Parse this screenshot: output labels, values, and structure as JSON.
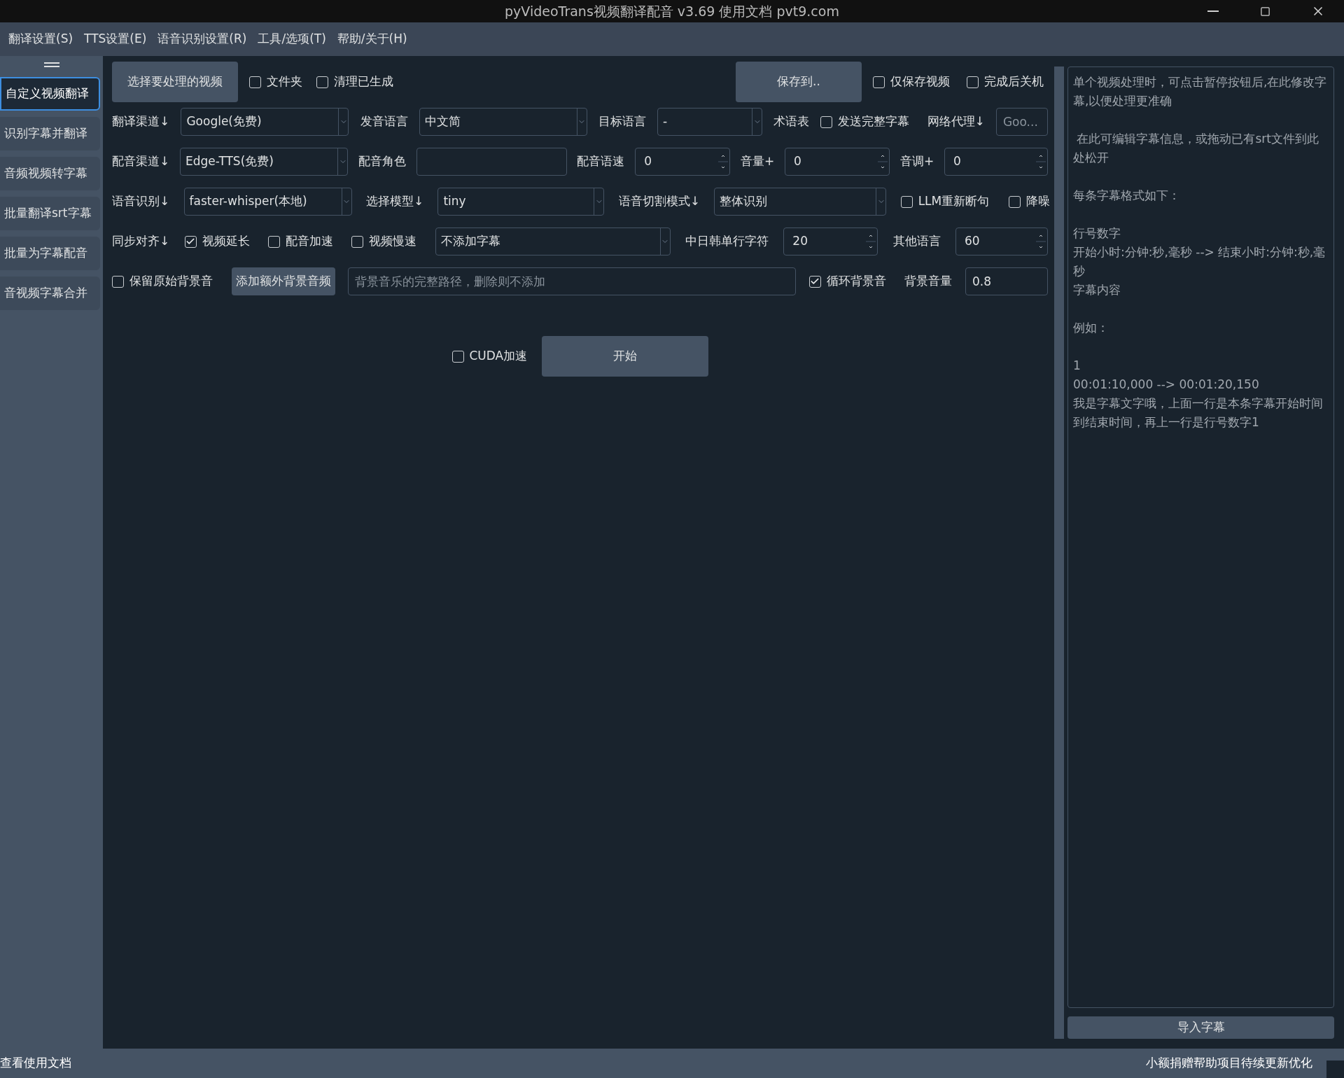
{
  "window": {
    "title": "pyVideoTrans视频翻译配音 v3.69 使用文档 pvt9.com"
  },
  "menu": [
    "翻译设置(S)",
    "TTS设置(E)",
    "语音识别设置(R)",
    "工具/选项(T)",
    "帮助/关于(H)"
  ],
  "sidebar": {
    "items": [
      {
        "label": "自定义视频翻译",
        "selected": true
      },
      {
        "label": "识别字幕并翻译",
        "selected": false
      },
      {
        "label": "音频视频转字幕",
        "selected": false
      },
      {
        "label": "批量翻译srt字幕",
        "selected": false
      },
      {
        "label": "批量为字幕配音",
        "selected": false
      },
      {
        "label": "音视频字幕合并",
        "selected": false
      }
    ]
  },
  "rows": [
    {
      "items": [
        {
          "kind": "button",
          "label": "选择要处理的视频"
        },
        {
          "kind": "checkbox",
          "label": "文件夹",
          "checked": false
        },
        {
          "kind": "checkbox",
          "label": "清理已生成",
          "checked": false
        },
        {
          "kind": "button",
          "label": "保存到.."
        },
        {
          "kind": "checkbox",
          "label": "仅保存视频",
          "checked": false
        },
        {
          "kind": "checkbox",
          "label": "完成后关机",
          "checked": false
        }
      ]
    },
    {
      "items": [
        {
          "kind": "label",
          "label": "翻译渠道↓"
        },
        {
          "kind": "combo",
          "value": "Google(免费)"
        },
        {
          "kind": "label",
          "label": "发音语言"
        },
        {
          "kind": "combo",
          "value": "中文简"
        },
        {
          "kind": "label",
          "label": "目标语言"
        },
        {
          "kind": "combo",
          "value": "-"
        },
        {
          "kind": "label",
          "label": "术语表"
        },
        {
          "kind": "checkbox",
          "label": "发送完整字幕",
          "checked": false
        },
        {
          "kind": "label",
          "label": "网络代理↓"
        },
        {
          "kind": "field",
          "placeholder": "Goo..."
        }
      ]
    },
    {
      "items": [
        {
          "kind": "label",
          "label": "配音渠道↓"
        },
        {
          "kind": "combo",
          "value": "Edge-TTS(免费)"
        },
        {
          "kind": "label",
          "label": "配音角色"
        },
        {
          "kind": "field"
        },
        {
          "kind": "label",
          "label": "配音语速"
        },
        {
          "kind": "spin",
          "value": "0"
        },
        {
          "kind": "label",
          "label": "音量+"
        },
        {
          "kind": "spin",
          "value": "0"
        },
        {
          "kind": "label",
          "label": "音调+"
        },
        {
          "kind": "spin",
          "value": "0"
        }
      ]
    },
    {
      "items": [
        {
          "kind": "label",
          "label": "语音识别↓"
        },
        {
          "kind": "combo",
          "value": "faster-whisper(本地)"
        },
        {
          "kind": "label",
          "label": "选择模型↓"
        },
        {
          "kind": "combo",
          "value": "tiny"
        },
        {
          "kind": "label",
          "label": "语音切割模式↓"
        },
        {
          "kind": "combo",
          "value": "整体识别"
        },
        {
          "kind": "checkbox",
          "label": "LLM重新断句",
          "checked": false
        },
        {
          "kind": "checkbox",
          "label": "降噪",
          "checked": false
        }
      ]
    },
    {
      "items": [
        {
          "kind": "label",
          "label": "同步对齐↓"
        },
        {
          "kind": "checkbox",
          "label": "视频延长",
          "checked": true
        },
        {
          "kind": "checkbox",
          "label": "配音加速",
          "checked": false
        },
        {
          "kind": "checkbox",
          "label": "视频慢速",
          "checked": false
        },
        {
          "kind": "combo",
          "value": "不添加字幕"
        },
        {
          "kind": "label",
          "label": "中日韩单行字符"
        },
        {
          "kind": "spin",
          "value": "20"
        },
        {
          "kind": "label",
          "label": "其他语言"
        },
        {
          "kind": "spin",
          "value": "60"
        }
      ]
    },
    {
      "items": [
        {
          "kind": "checkbox",
          "label": "保留原始背景音",
          "checked": false
        },
        {
          "kind": "button",
          "label": "添加额外背景音频"
        },
        {
          "kind": "field",
          "placeholder": "背景音乐的完整路径，删除则不添加"
        },
        {
          "kind": "checkbox",
          "label": "循环背景音",
          "checked": true
        },
        {
          "kind": "label",
          "label": "背景音量"
        },
        {
          "kind": "field",
          "value": "0.8"
        }
      ]
    },
    {
      "items": [
        {
          "kind": "checkbox",
          "label": "CUDA加速",
          "checked": false
        },
        {
          "kind": "button",
          "label": "开始"
        }
      ]
    }
  ],
  "subtitle_editor": {
    "placeholder": [
      [
        "单个视频处理时，可点击暂停按钮后,在此修改字幕,以便处理更准确"
      ],
      [
        " 在此可编辑字幕信息，或拖动已有srt文件到此处松开"
      ],
      [
        "每条字幕格式如下："
      ],
      [
        "行号数字",
        "开始小时:分钟:秒,毫秒 --> 结束小时:分钟:秒,毫秒",
        "字幕内容"
      ],
      [
        "例如："
      ],
      [
        "1",
        "00:01:10,000 --> 00:01:20,150",
        "我是字幕文字哦，上面一行是本条字幕开始时间到结束时间，再上一行是行号数字1"
      ]
    ]
  },
  "import_button": "导入字幕",
  "status_bar": {
    "left": "查看使用文档",
    "right": "小额捐赠帮助项目待续更新优化"
  }
}
